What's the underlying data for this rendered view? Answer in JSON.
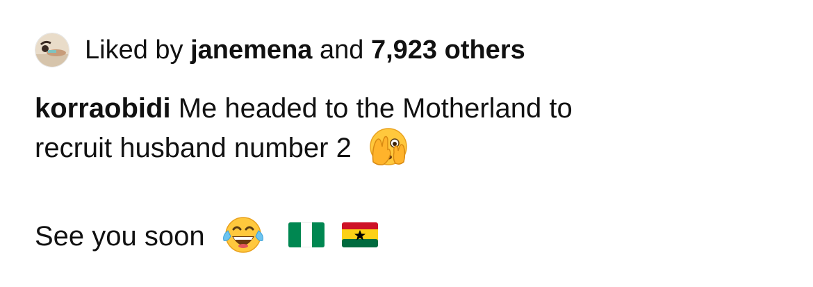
{
  "likes": {
    "prefix": "Liked by",
    "user": "janemena",
    "conjunction": "and",
    "count": "7,923 others"
  },
  "caption": {
    "username": "korraobidi",
    "line1": "Me headed to the Motherland to",
    "line2": "recruit husband number 2",
    "line3": "See you soon"
  },
  "icons": {
    "avatar": "liker-avatar",
    "emoji_1": "face-with-hand-over-eyes-emoji",
    "emoji_2": "face-with-tears-of-joy-emoji",
    "flag_1": "nigeria-flag",
    "flag_2": "ghana-flag"
  },
  "colors": {
    "text": "#111111",
    "nigeria_green": "#008751",
    "ghana_red": "#CE1126",
    "ghana_gold": "#FCD116",
    "ghana_green": "#006B3F"
  }
}
